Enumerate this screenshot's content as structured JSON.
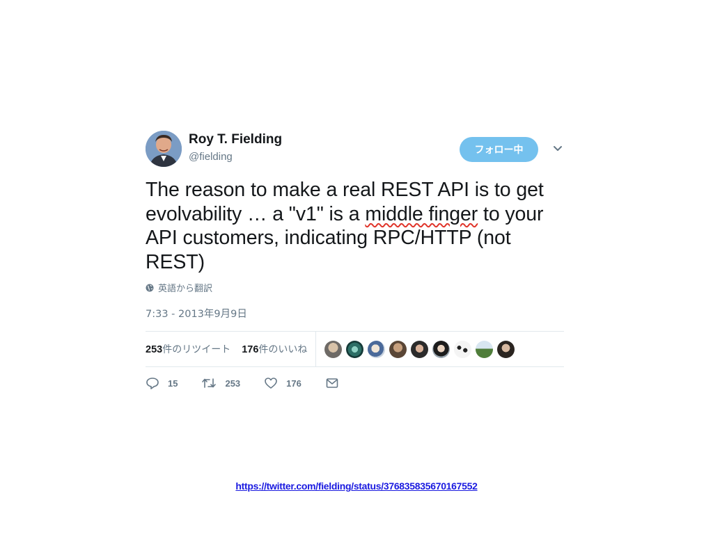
{
  "tweet": {
    "author_name": "Roy T. Fielding",
    "author_handle": "@fielding",
    "follow_label": "フォロー中",
    "text_part1": "The reason to make a real REST API is to get evolvability … a \"v1\" is a ",
    "text_underlined": "middle finger",
    "text_part2": " to your API customers, indicating RPC/HTTP (not REST)",
    "translate_label": "英語から翻訳",
    "timestamp": "7:33 - 2013年9月9日",
    "retweets_count": "253",
    "retweets_label": "件のリツイート",
    "likes_count": "176",
    "likes_label": "件のいいね",
    "liker_avatars": 9,
    "actions": {
      "reply_count": "15",
      "retweet_count": "253",
      "like_count": "176"
    }
  },
  "source_link": "https://twitter.com/fielding/status/376835835670167552",
  "colors": {
    "follow_button": "#74c1ee",
    "secondary_text": "#657786",
    "link": "#1a1ae0",
    "spell_underline": "#e0352b"
  },
  "icons": [
    "globe-icon",
    "caret-down-icon",
    "reply-icon",
    "retweet-icon",
    "heart-icon",
    "mail-icon"
  ]
}
